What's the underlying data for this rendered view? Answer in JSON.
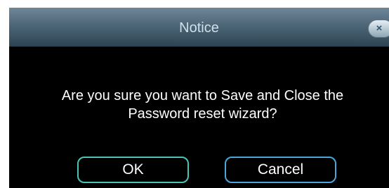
{
  "dialog": {
    "title": "Notice",
    "close_label": "×",
    "message_line1": "Are you sure you want to Save and Close the",
    "message_line2": "Password reset wizard?",
    "buttons": {
      "ok_label": "OK",
      "cancel_label": "Cancel"
    }
  },
  "colors": {
    "title_bar": "#4d6778",
    "ok_border": "#49c4b6",
    "cancel_border": "#4aa8d8"
  }
}
